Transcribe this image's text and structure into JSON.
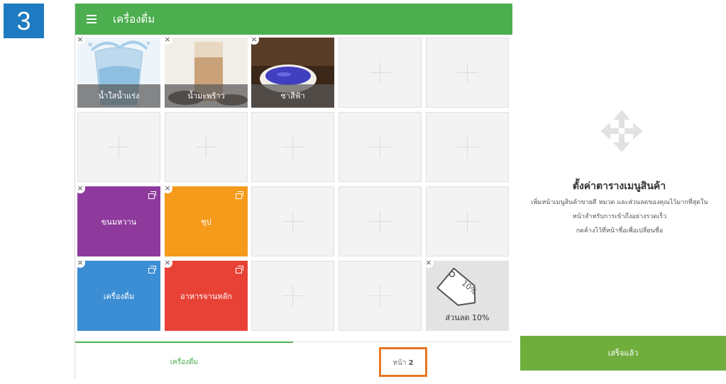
{
  "step_number": "3",
  "header": {
    "title": "เครื่องดื่ม",
    "menu_icon": "hamburger-menu-icon"
  },
  "tiles": {
    "water": {
      "label": "น้ำใสน้ำแร่ง"
    },
    "coconut": {
      "label": "น้ำมะพร้าว"
    },
    "blue_tea": {
      "label": "ชาสีฟ้า"
    },
    "dessert": {
      "label": "ขนมหวาน",
      "color": "#8e3a9d"
    },
    "soup": {
      "label": "ซุป",
      "color": "#f59a1b"
    },
    "drinks": {
      "label": "เครื่องดื่ม",
      "color": "#3b8dd4"
    },
    "main_dish": {
      "label": "อาหารจานหลัก",
      "color": "#e84237"
    },
    "discount": {
      "label": "ส่วนลด 10%",
      "tag_text": "10%"
    }
  },
  "remove_glyph": "×",
  "footer": {
    "category_tab": "เครื่องดื่ม",
    "page_tab_prefix": "หน้า",
    "page_number": "2"
  },
  "side_panel": {
    "title": "ตั้งค่าตารางเมนูสินค้า",
    "description_lines": [
      "เพิ่มหน้าเมนูสินค้าขายดี หมวด และส่วนลดของคุณไว้มากที่สุดใน",
      "หน้าสำหรับการเข้าถึงอย่างรวดเร็ว",
      "กดค้างไว้ที่หน้าชื่อเพื่อเปลี่ยนชื่อ"
    ],
    "done_button": "เสร็จแล้ว"
  },
  "colors": {
    "accent": "#4cae4f",
    "done_button": "#6fae3d",
    "step_badge": "#1f7bc1",
    "highlight_box": "#e87722"
  }
}
